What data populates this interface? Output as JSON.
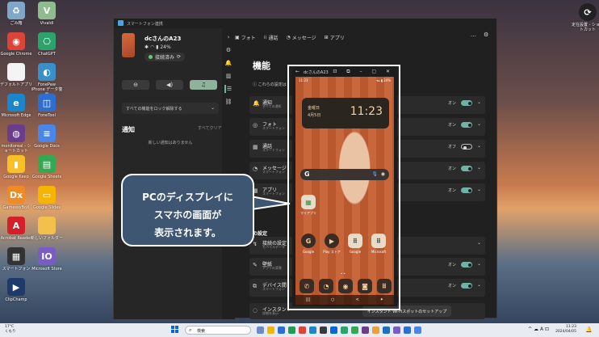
{
  "desktop": {
    "icons_left": [
      {
        "label": "ごみ箱",
        "glyph": "♻",
        "color": "#7fa7c8"
      },
      {
        "label": "Google Chrome",
        "glyph": "◉",
        "color": "#db4437"
      },
      {
        "label": "デフォルトアプリ",
        "glyph": "",
        "color": "#f4f4f4"
      },
      {
        "label": "Microsoft Edge",
        "glyph": "e",
        "color": "#1b86c9"
      },
      {
        "label": "monitoreal - ショートカット",
        "glyph": "◍",
        "color": "#6a3c8c"
      },
      {
        "label": "Google Keep",
        "glyph": "▮",
        "color": "#f6c026"
      },
      {
        "label": "GamessyBoX",
        "glyph": "Dx",
        "color": "#f08a24"
      },
      {
        "label": "Acrobat Reader",
        "glyph": "A",
        "color": "#d4202a"
      },
      {
        "label": "スマートフォン",
        "glyph": "▦",
        "color": "#333333"
      },
      {
        "label": "ClipChamp",
        "glyph": "▶",
        "color": "#1e3a6a"
      }
    ],
    "icons_right": [
      {
        "label": "Vivaldi",
        "glyph": "V",
        "color": "#8fbc8f"
      },
      {
        "label": "ChatGPT",
        "glyph": "⎔",
        "color": "#2ca36b"
      },
      {
        "label": "FonePaw iPhone データ復元",
        "glyph": "◐",
        "color": "#3b8fc9"
      },
      {
        "label": "FoneTool",
        "glyph": "◫",
        "color": "#2d6fcf"
      },
      {
        "label": "Google Docs",
        "glyph": "≡",
        "color": "#4a86e8"
      },
      {
        "label": "Google Sheets",
        "glyph": "▤",
        "color": "#34a853"
      },
      {
        "label": "Google Slides",
        "glyph": "▭",
        "color": "#f4b400"
      },
      {
        "label": "新しいフォルダー",
        "glyph": "",
        "color": "#f3c14b"
      },
      {
        "label": "Microsoft Store",
        "glyph": "IO",
        "color": "#7a5cc4"
      }
    ],
    "top_right_icon_label": "定在設置 - ショートカット"
  },
  "phone_link": {
    "app_title": "スマートフォン連携",
    "device_name": "dcさんのA23",
    "battery": "24%",
    "connection_status": "接続済み",
    "do_not_disturb": "すべての機能をロック解除する",
    "notifications_title": "通知",
    "clear_all": "すべてクリア",
    "no_notifications": "新しい通知はありません",
    "nav": {
      "photos": "フォト",
      "calls": "通話",
      "messages": "メッセージ",
      "apps": "アプリ"
    },
    "settings_title": "機能",
    "settings_intro": "これらの設定は",
    "rows": [
      {
        "title": "通知",
        "sub": "すべての通知",
        "status": "オン",
        "on": true,
        "icon": "🔔"
      },
      {
        "title": "フォト",
        "sub": "スマートフォン",
        "status": "オン",
        "on": true,
        "icon": "◎"
      },
      {
        "title": "通話",
        "sub": "スマートフォン",
        "status": "オフ",
        "on": false,
        "icon": "▦"
      },
      {
        "title": "メッセージ",
        "sub": "スマートフォン",
        "status": "オン",
        "on": true,
        "icon": "◔"
      },
      {
        "title": "アプリ",
        "sub": "スマートフォン",
        "status": "オン",
        "on": true,
        "icon": "▦"
      }
    ],
    "section2_title": "の設定",
    "rows2": [
      {
        "title": "接続の設定",
        "sub": "モバイルデータ",
        "icon": "↯"
      },
      {
        "title": "壁紙",
        "sub": "アプリの背景",
        "icon": "✎"
      },
      {
        "title": "デバイス間",
        "sub": "スマートフォン",
        "icon": "⧉"
      },
      {
        "title": "インスタント",
        "sub": "詳細を表示",
        "icon": "◌"
      }
    ],
    "rows2_status": "オン",
    "hotspot_button": "インスタント Wi-Fiスポットのセットアップ",
    "colors": {
      "toggle_on": "#6fb3a6",
      "window_bg": "#202020"
    }
  },
  "mirror": {
    "window_title": "dcさんのA23",
    "status_time": "11:23",
    "status_right": "▾▴ ▮ 24%",
    "clock_day": "金曜日",
    "clock_date": "4月5日",
    "clock_time": "11:23",
    "google_label": "G",
    "folder_app": "マイアプリ",
    "dock_apps": [
      {
        "label": "Google",
        "glyph": "G",
        "color": "#3a2c22"
      },
      {
        "label": "Play ストア",
        "glyph": "▶",
        "color": "#3a2c22"
      },
      {
        "label": "Google",
        "glyph": "⠿",
        "color": "#e8dcc8"
      },
      {
        "label": "Microsoft",
        "glyph": "⠿",
        "color": "#e8dcc8"
      }
    ],
    "bottom_apps": [
      {
        "glyph": "✆",
        "color": "#3a2c22"
      },
      {
        "glyph": "◔",
        "color": "#3a2c22"
      },
      {
        "glyph": "◉",
        "color": "#3a2c22"
      },
      {
        "glyph": "◙",
        "color": "#3a2c22"
      },
      {
        "glyph": "⠿",
        "color": "#3a2c22"
      }
    ],
    "nav": {
      "recent": "|||",
      "home": "○",
      "back": "<",
      "extra": "✦"
    }
  },
  "callout": {
    "line1": "PCのディスプレイに",
    "line2": "スマホの画面が",
    "line3": "表示されます。"
  },
  "taskbar": {
    "temp": "17°C",
    "weather": "くもり",
    "search_placeholder": "検索",
    "time": "11:23",
    "date": "2024/04/05",
    "tray": "^ ☁ A ⊡"
  }
}
